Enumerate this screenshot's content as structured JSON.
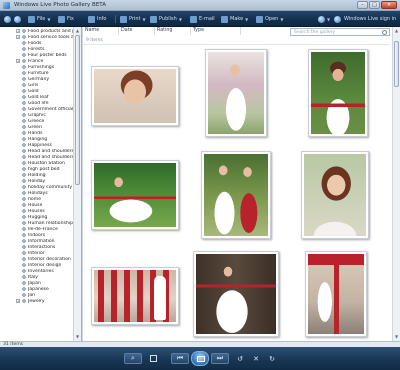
{
  "window": {
    "title": "Windows Live Photo Gallery BETA",
    "minimize": "–",
    "maximize": "□",
    "close": "✕"
  },
  "toolbar": {
    "file": "File",
    "fix": "Fix",
    "info": "Info",
    "print": "Print",
    "publish": "Publish",
    "email": "E-mail",
    "make": "Make",
    "open": "Open",
    "sign_in": "Windows Live sign in"
  },
  "search": {
    "placeholder": "Search the gallery"
  },
  "columns": [
    "Name",
    "Date",
    "Rating",
    "Type"
  ],
  "item_count": "9 items",
  "nav": {
    "items": [
      {
        "label": "Food products and prepared",
        "state": "+"
      },
      {
        "label": "Food service tools and",
        "state": "+"
      },
      {
        "label": "Foods",
        "state": ""
      },
      {
        "label": "Forests",
        "state": ""
      },
      {
        "label": "Four poster beds",
        "state": ""
      },
      {
        "label": "France",
        "state": "+"
      },
      {
        "label": "Furnishings",
        "state": ""
      },
      {
        "label": "Furniture",
        "state": ""
      },
      {
        "label": "Germany",
        "state": ""
      },
      {
        "label": "Girls",
        "state": ""
      },
      {
        "label": "Gold",
        "state": ""
      },
      {
        "label": "Gold leaf",
        "state": ""
      },
      {
        "label": "Good life",
        "state": ""
      },
      {
        "label": "Government officials",
        "state": ""
      },
      {
        "label": "Graphic",
        "state": ""
      },
      {
        "label": "Greece",
        "state": ""
      },
      {
        "label": "Green",
        "state": ""
      },
      {
        "label": "Hands",
        "state": ""
      },
      {
        "label": "Hanging",
        "state": ""
      },
      {
        "label": "Happiness",
        "state": ""
      },
      {
        "label": "Head and shoulders",
        "state": ""
      },
      {
        "label": "Head and shoulders portr",
        "state": ""
      },
      {
        "label": "Houston Station",
        "state": ""
      },
      {
        "label": "high post bed",
        "state": ""
      },
      {
        "label": "Holding",
        "state": ""
      },
      {
        "label": "Holiday",
        "state": ""
      },
      {
        "label": "holiday community",
        "state": ""
      },
      {
        "label": "Holidays",
        "state": ""
      },
      {
        "label": "home",
        "state": ""
      },
      {
        "label": "House",
        "state": ""
      },
      {
        "label": "Houses",
        "state": ""
      },
      {
        "label": "Hugging",
        "state": ""
      },
      {
        "label": "Human relationships",
        "state": ""
      },
      {
        "label": "Ile-de-France",
        "state": ""
      },
      {
        "label": "Indoors",
        "state": ""
      },
      {
        "label": "Information",
        "state": ""
      },
      {
        "label": "Interactions",
        "state": ""
      },
      {
        "label": "Interior",
        "state": ""
      },
      {
        "label": "Interior decoration",
        "state": ""
      },
      {
        "label": "Interior design",
        "state": ""
      },
      {
        "label": "Inventories",
        "state": ""
      },
      {
        "label": "Italy",
        "state": ""
      },
      {
        "label": "Japan",
        "state": ""
      },
      {
        "label": "Japanese",
        "state": ""
      },
      {
        "label": "Jan",
        "state": ""
      },
      {
        "label": "Jewelry",
        "state": "+"
      }
    ]
  },
  "photos": [
    {
      "subject": "bride-portrait"
    },
    {
      "subject": "bride-standing-blossoms"
    },
    {
      "subject": "bride-garden"
    },
    {
      "subject": "bride-seated-lawn"
    },
    {
      "subject": "bride-with-bridesmaid"
    },
    {
      "subject": "bride-closeup"
    },
    {
      "subject": "bridesmaids-group"
    },
    {
      "subject": "bride-at-door"
    },
    {
      "subject": "bridal-party-street"
    }
  ],
  "status": {
    "count": "31 items"
  },
  "controls": {
    "zoom": "⌕",
    "prev": "⏮",
    "slideshow": "slideshow",
    "next": "⏭",
    "rotate_ccw": "↺",
    "delete": "✕",
    "rotate_cw": "↻"
  },
  "colors": {
    "toolbar": "#173553",
    "accent_red": "#b8232b",
    "window_bg": "#ffffff"
  }
}
